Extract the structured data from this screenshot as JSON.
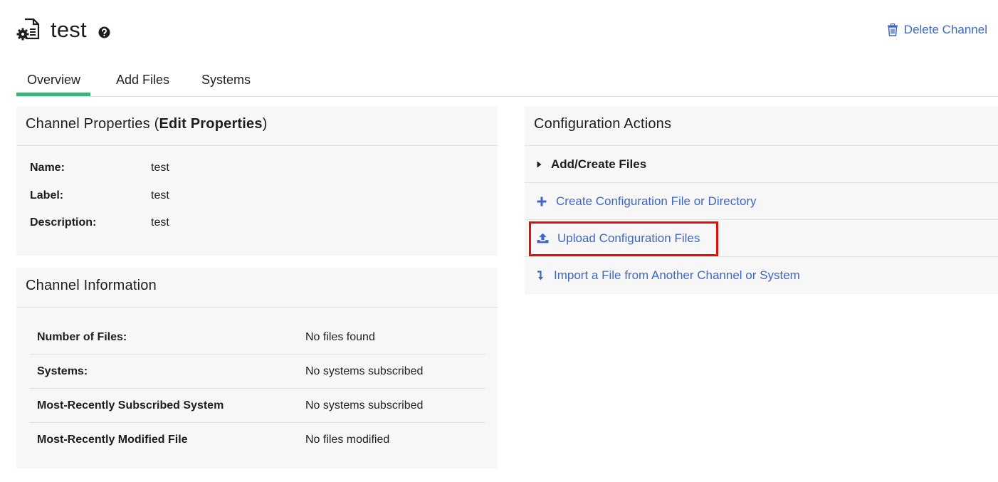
{
  "header": {
    "title": "test",
    "delete_label": "Delete Channel",
    "icons": {
      "page": "config-file-icon",
      "help": "help-icon",
      "delete": "trash-icon"
    }
  },
  "tabs": [
    {
      "label": "Overview",
      "active": true
    },
    {
      "label": "Add Files",
      "active": false
    },
    {
      "label": "Systems",
      "active": false
    }
  ],
  "channel_properties": {
    "heading_prefix": "Channel Properties (",
    "edit_link": "Edit Properties",
    "heading_suffix": ")",
    "rows": [
      {
        "label": "Name:",
        "value": "test"
      },
      {
        "label": "Label:",
        "value": "test"
      },
      {
        "label": "Description:",
        "value": "test"
      }
    ]
  },
  "channel_information": {
    "heading": "Channel Information",
    "rows": [
      {
        "label": "Number of Files:",
        "value": "No files found"
      },
      {
        "label": "Systems:",
        "value": "No systems subscribed"
      },
      {
        "label": "Most-Recently Subscribed System",
        "value": "No systems subscribed"
      },
      {
        "label": "Most-Recently Modified File",
        "value": "No files modified"
      }
    ]
  },
  "configuration_actions": {
    "heading": "Configuration Actions",
    "section_label": "Add/Create Files",
    "actions": [
      {
        "label": "Create Configuration File or Directory",
        "icon": "plus-icon"
      },
      {
        "label": "Upload Configuration Files",
        "icon": "upload-icon"
      },
      {
        "label": "Import a File from Another Channel or System",
        "icon": "import-arrow-icon"
      }
    ]
  },
  "colors": {
    "link": "#3d66c7",
    "active_tab": "#3eb07c",
    "highlight": "#e00d0d",
    "panel_bg": "#f7f7f7"
  }
}
